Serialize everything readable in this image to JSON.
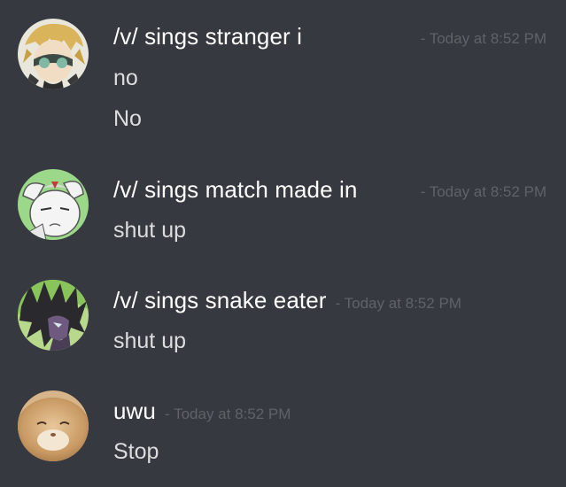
{
  "messages": [
    {
      "username": "/v/ sings stranger i",
      "timestamp": "- Today at 8:52 PM",
      "lines": [
        "no",
        "No"
      ],
      "avatar_icon": "anime-character-goggles-avatar"
    },
    {
      "username": "/v/ sings match made in",
      "timestamp": "- Today at 8:52 PM",
      "lines": [
        "shut up"
      ],
      "avatar_icon": "white-creature-avatar"
    },
    {
      "username": "/v/ sings snake eater",
      "timestamp": "- Today at 8:52 PM",
      "lines": [
        "shut up"
      ],
      "avatar_icon": "dark-spiky-hair-character-avatar"
    },
    {
      "username": "uwu",
      "timestamp": "- Today at 8:52 PM",
      "lines": [
        "Stop"
      ],
      "avatar_icon": "hamster-avatar"
    }
  ],
  "colors": {
    "background": "#36393f",
    "username": "#ffffff",
    "message_text": "#dcddde",
    "timestamp": "#5f6266"
  }
}
